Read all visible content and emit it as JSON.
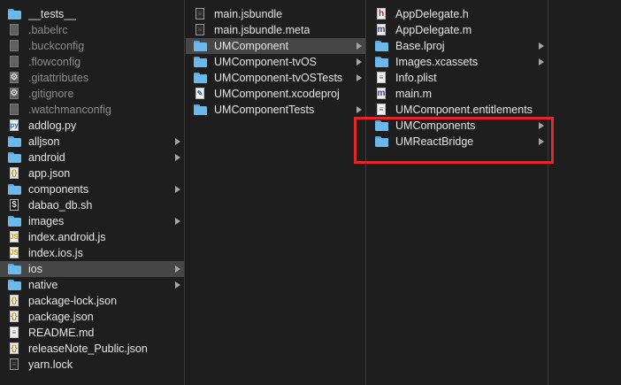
{
  "columns": [
    {
      "items": [
        {
          "label": "__tests__",
          "icon": "folder-icon",
          "dim": false,
          "arrow": false
        },
        {
          "label": ".babelrc",
          "icon": "file-icon",
          "dim": true,
          "arrow": false
        },
        {
          "label": ".buckconfig",
          "icon": "file-icon",
          "dim": true,
          "arrow": false
        },
        {
          "label": ".flowconfig",
          "icon": "file-icon",
          "dim": true,
          "arrow": false
        },
        {
          "label": ".gitattributes",
          "icon": "gear-file-icon",
          "dim": true,
          "arrow": false
        },
        {
          "label": ".gitignore",
          "icon": "gear-file-icon",
          "dim": true,
          "arrow": false
        },
        {
          "label": ".watchmanconfig",
          "icon": "file-icon",
          "dim": true,
          "arrow": false
        },
        {
          "label": "addlog.py",
          "icon": "python-file-icon",
          "dim": false,
          "arrow": false
        },
        {
          "label": "alljson",
          "icon": "folder-icon",
          "dim": false,
          "arrow": true
        },
        {
          "label": "android",
          "icon": "folder-icon",
          "dim": false,
          "arrow": true
        },
        {
          "label": "app.json",
          "icon": "json-file-icon",
          "dim": false,
          "arrow": false
        },
        {
          "label": "components",
          "icon": "folder-icon",
          "dim": false,
          "arrow": true
        },
        {
          "label": "dabao_db.sh",
          "icon": "shell-file-icon",
          "dim": false,
          "arrow": false
        },
        {
          "label": "images",
          "icon": "folder-icon",
          "dim": false,
          "arrow": true
        },
        {
          "label": "index.android.js",
          "icon": "js-file-icon",
          "dim": false,
          "arrow": false
        },
        {
          "label": "index.ios.js",
          "icon": "js-file-icon",
          "dim": false,
          "arrow": false
        },
        {
          "label": "ios",
          "icon": "folder-icon",
          "dim": false,
          "arrow": true,
          "selected": true
        },
        {
          "label": "native",
          "icon": "folder-icon",
          "dim": false,
          "arrow": true
        },
        {
          "label": "package-lock.json",
          "icon": "json-file-icon",
          "dim": false,
          "arrow": false
        },
        {
          "label": "package.json",
          "icon": "json-file-icon",
          "dim": false,
          "arrow": false
        },
        {
          "label": "README.md",
          "icon": "text-file-icon",
          "dim": false,
          "arrow": false
        },
        {
          "label": "releaseNote_Public.json",
          "icon": "json-file-icon",
          "dim": false,
          "arrow": false
        },
        {
          "label": "yarn.lock",
          "icon": "lock-file-icon",
          "dim": false,
          "arrow": false
        }
      ]
    },
    {
      "items": [
        {
          "label": "main.jsbundle",
          "icon": "bundle-file-icon",
          "dim": false,
          "arrow": false
        },
        {
          "label": "main.jsbundle.meta",
          "icon": "bundle-file-icon",
          "dim": false,
          "arrow": false
        },
        {
          "label": "UMComponent",
          "icon": "folder-icon",
          "dim": false,
          "arrow": true,
          "selected": true
        },
        {
          "label": "UMComponent-tvOS",
          "icon": "folder-icon",
          "dim": false,
          "arrow": true
        },
        {
          "label": "UMComponent-tvOSTests",
          "icon": "folder-icon",
          "dim": false,
          "arrow": true
        },
        {
          "label": "UMComponent.xcodeproj",
          "icon": "xcodeproj-icon",
          "dim": false,
          "arrow": false
        },
        {
          "label": "UMComponentTests",
          "icon": "folder-icon",
          "dim": false,
          "arrow": true
        }
      ]
    },
    {
      "items": [
        {
          "label": "AppDelegate.h",
          "icon": "header-file-icon",
          "dim": false,
          "arrow": false
        },
        {
          "label": "AppDelegate.m",
          "icon": "objc-file-icon",
          "dim": false,
          "arrow": false
        },
        {
          "label": "Base.lproj",
          "icon": "folder-icon",
          "dim": false,
          "arrow": true
        },
        {
          "label": "Images.xcassets",
          "icon": "folder-icon",
          "dim": false,
          "arrow": true
        },
        {
          "label": "Info.plist",
          "icon": "plist-file-icon",
          "dim": false,
          "arrow": false
        },
        {
          "label": "main.m",
          "icon": "objc-file-icon",
          "dim": false,
          "arrow": false
        },
        {
          "label": "UMComponent.entitlements",
          "icon": "entitlements-file-icon",
          "dim": false,
          "arrow": false
        },
        {
          "label": "UMComponents",
          "icon": "folder-icon",
          "dim": false,
          "arrow": true
        },
        {
          "label": "UMReactBridge",
          "icon": "folder-icon",
          "dim": false,
          "arrow": true
        }
      ]
    }
  ],
  "highlight_color": "#e3262a",
  "selection_color": "#464646",
  "folder_color": "#6ab9ea"
}
